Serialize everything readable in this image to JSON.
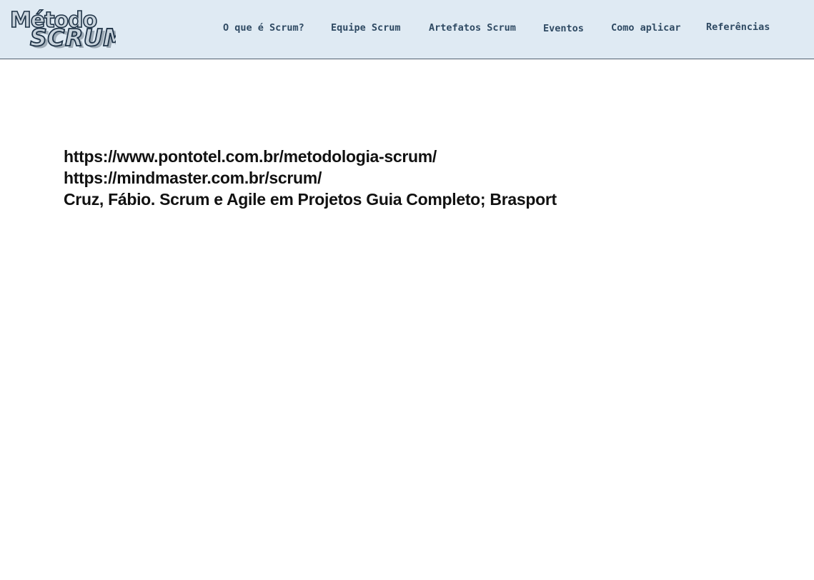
{
  "header": {
    "logo": {
      "line1": "Método",
      "line2": "SCRUM"
    },
    "nav": [
      {
        "label": "O que é Scrum?"
      },
      {
        "label": "Equipe Scrum"
      },
      {
        "label": "Artefatos Scrum"
      },
      {
        "label": "Eventos"
      },
      {
        "label": "Como aplicar"
      },
      {
        "label": "Referências"
      }
    ]
  },
  "main": {
    "references": [
      "https://www.pontotel.com.br/metodologia-scrum/",
      "https://mindmaster.com.br/scrum/",
      "Cruz, Fábio. Scrum e Agile em Projetos Guia Completo; Brasport"
    ]
  },
  "colors": {
    "header_bg": "#dfeaf3",
    "nav_text": "#2f4a63",
    "logo_fill": "#c9d4dd",
    "logo_stroke": "#1f3347",
    "body_text": "#111111"
  }
}
